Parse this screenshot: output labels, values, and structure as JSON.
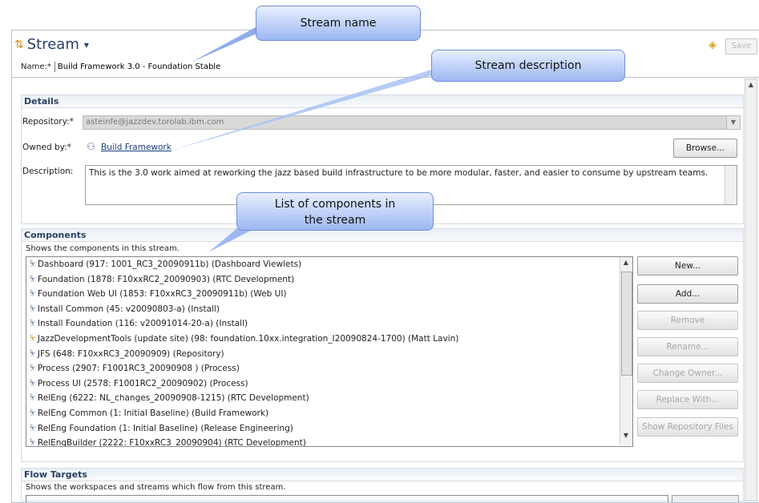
{
  "editor": {
    "title": "Stream",
    "save_label": "Save",
    "name_label": "Name:*",
    "name_value": "Build Framework 3.0 - Foundation Stable"
  },
  "details": {
    "header": "Details",
    "repository_label": "Repository:*",
    "repository_value": "asteinfe@jazzdev.torolab.ibm.com",
    "owned_by_label": "Owned by:*",
    "owned_by_value": "Build Framework",
    "browse_label": "Browse...",
    "description_label": "Description:",
    "description_value": "This is the 3.0 work aimed at reworking the jazz based build infrastructure to be more modular, faster, and easier to consume by upstream teams."
  },
  "components": {
    "header": "Components",
    "subtitle": "Shows the components in this stream.",
    "items": [
      "Dashboard (917: 1001_RC3_20090911b) (Dashboard Viewlets)",
      "Foundation (1878: F10xxRC2_20090903) (RTC Development)",
      "Foundation Web UI (1853: F10xxRC3_20090911b) (Web UI)",
      "Install Common (45: v20090803-a) (Install)",
      "Install Foundation (116: v20091014-20-a) (Install)",
      "JazzDevelopmentTools (update site) (98: foundation.10xx.integration_I20090824-1700) (Matt Lavin)",
      "JFS (648: F10xxRC3_20090909) (Repository)",
      "Process (2907: F1001RC3_20090908 ) (Process)",
      "Process UI (2578: F1001RC2_20090902) (Process)",
      "RelEng (6222: NL_changes_20090908-1215) (RTC Development)",
      "RelEng Common (1: Initial Baseline) (Build Framework)",
      "RelEng Foundation (1: Initial Baseline) (Release Engineering)",
      "RelEngBuilder (2222: F10xxRC3_20090904) (RTC Development)"
    ],
    "buttons": {
      "new": "New...",
      "add": "Add...",
      "remove": "Remove",
      "rename": "Rename...",
      "change_owner": "Change Owner...",
      "replace_with": "Replace With...",
      "show_repo_files": "Show Repository Files"
    }
  },
  "flow_targets": {
    "header": "Flow Targets",
    "subtitle": "Shows the workspaces and streams which flow from this stream."
  },
  "callouts": {
    "stream_name": "Stream name",
    "stream_description": "Stream description",
    "components_list_line1": "List of components in",
    "components_list_line2": "the stream"
  }
}
